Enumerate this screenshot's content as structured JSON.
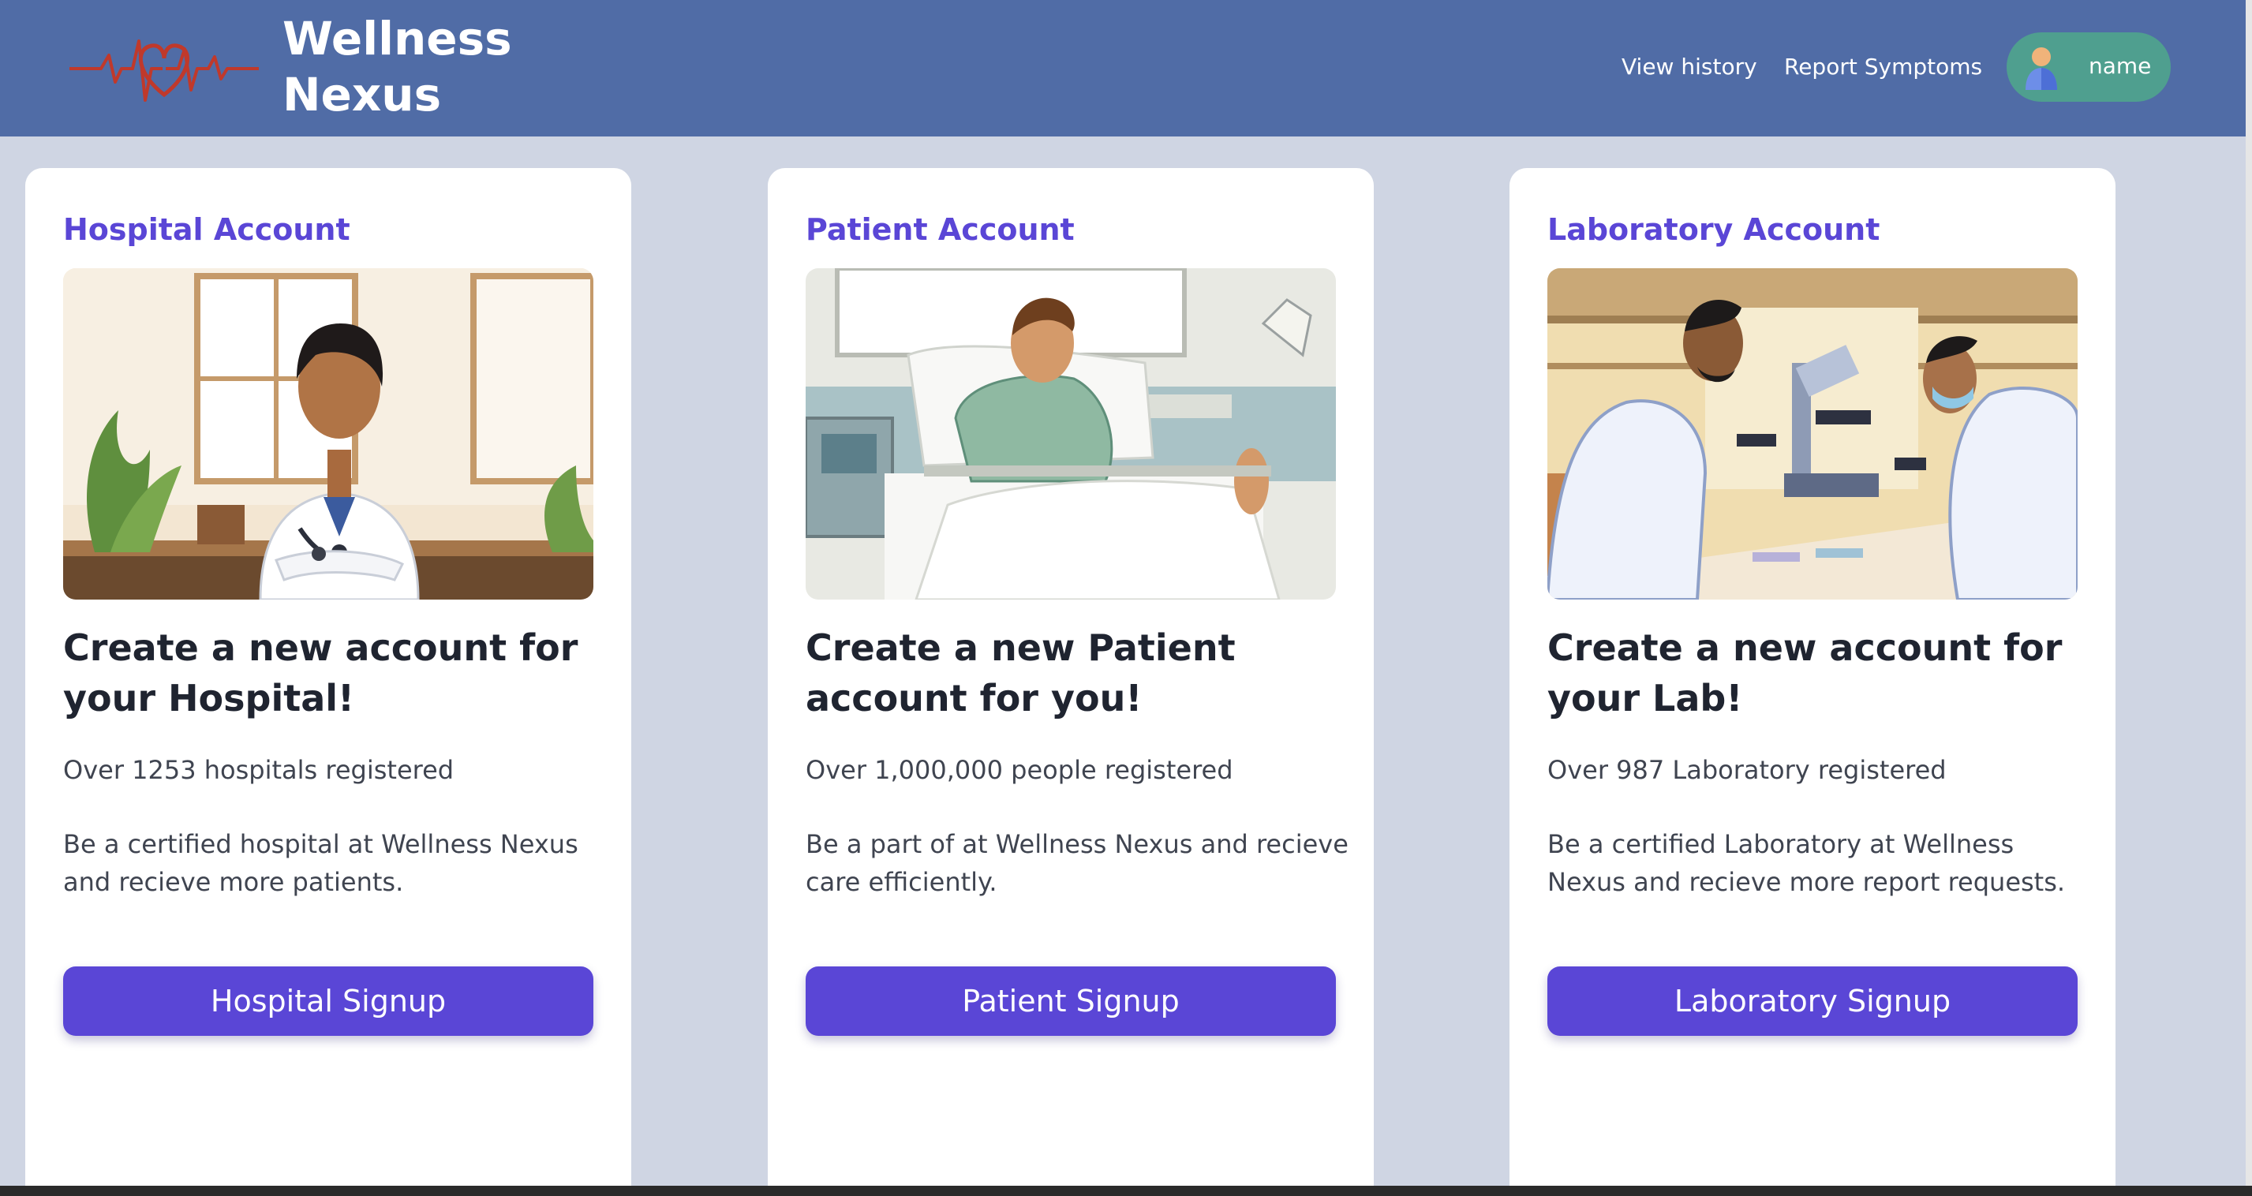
{
  "header": {
    "brand_line1": "Wellness",
    "brand_line2": "Nexus",
    "logo_icon": "heartbeat-heart-icon",
    "nav": {
      "view_history": "View history",
      "report_symptoms": "Report Symptoms"
    },
    "profile": {
      "name": "name",
      "avatar_icon": "user-avatar-icon"
    }
  },
  "colors": {
    "header_bg": "#506ca6",
    "page_bg": "#cfd5e3",
    "accent": "#5a46d6",
    "profile_bg": "#4f9f8f"
  },
  "cards": [
    {
      "title": "Hospital Account",
      "image": "doctor-illustration",
      "heading": "Create a new account for your Hospital!",
      "stat": "Over 1253 hospitals registered",
      "description": "Be a certified hospital at Wellness Nexus and recieve more patients.",
      "button": "Hospital Signup"
    },
    {
      "title": "Patient Account",
      "image": "patient-in-bed-illustration",
      "heading": "Create a new Patient account for you!",
      "stat": "Over 1,000,000 people registered",
      "description": "Be a part of at Wellness Nexus and recieve care efficiently.",
      "button": "Patient Signup"
    },
    {
      "title": "Laboratory Account",
      "image": "lab-scientists-illustration",
      "heading": "Create a new account for your Lab!",
      "stat": "Over 987 Laboratory registered",
      "description": "Be a certified Laboratory at Wellness Nexus and recieve more report requests.",
      "button": "Laboratory Signup"
    }
  ]
}
